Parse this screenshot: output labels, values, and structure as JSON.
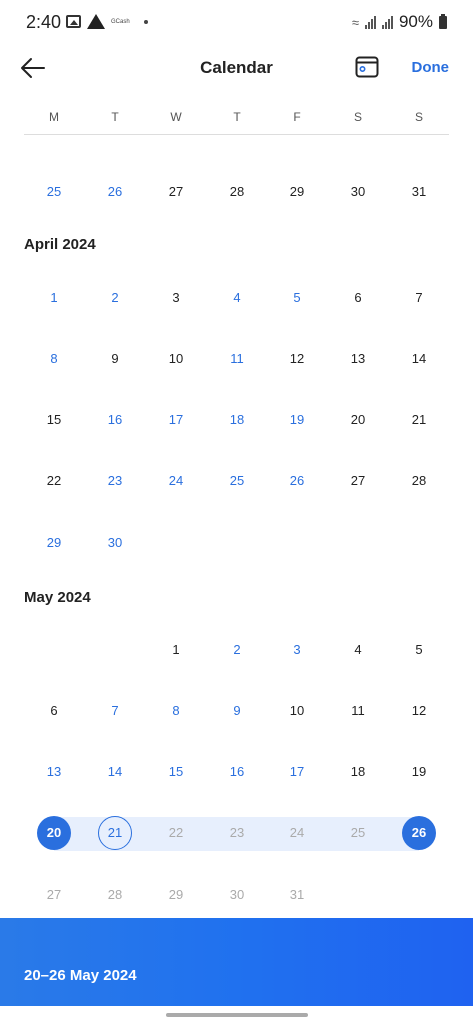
{
  "status": {
    "time": "2:40",
    "notification_text": "GCash",
    "battery": "90%"
  },
  "header": {
    "title": "Calendar",
    "done_label": "Done",
    "back_icon": "arrow-left-icon",
    "today_icon": "calendar-today-icon"
  },
  "weekdays": [
    "M",
    "T",
    "W",
    "T",
    "F",
    "S",
    "S"
  ],
  "colors": {
    "accent": "#2a6fde",
    "range_band": "#e7effd",
    "muted": "#aaaaaa"
  },
  "calendar": {
    "previous_week": [
      {
        "label": "25",
        "state": "avail"
      },
      {
        "label": "26",
        "state": "avail"
      },
      {
        "label": "27",
        "state": "normal"
      },
      {
        "label": "28",
        "state": "normal"
      },
      {
        "label": "29",
        "state": "normal"
      },
      {
        "label": "30",
        "state": "normal"
      },
      {
        "label": "31",
        "state": "normal"
      }
    ],
    "months": [
      {
        "title": "April 2024",
        "leading_blanks": 0,
        "days": [
          {
            "label": "1",
            "state": "avail"
          },
          {
            "label": "2",
            "state": "avail"
          },
          {
            "label": "3",
            "state": "normal"
          },
          {
            "label": "4",
            "state": "avail"
          },
          {
            "label": "5",
            "state": "avail"
          },
          {
            "label": "6",
            "state": "normal"
          },
          {
            "label": "7",
            "state": "normal"
          },
          {
            "label": "8",
            "state": "avail"
          },
          {
            "label": "9",
            "state": "normal"
          },
          {
            "label": "10",
            "state": "normal"
          },
          {
            "label": "11",
            "state": "avail"
          },
          {
            "label": "12",
            "state": "normal"
          },
          {
            "label": "13",
            "state": "normal"
          },
          {
            "label": "14",
            "state": "normal"
          },
          {
            "label": "15",
            "state": "normal"
          },
          {
            "label": "16",
            "state": "avail"
          },
          {
            "label": "17",
            "state": "avail"
          },
          {
            "label": "18",
            "state": "avail"
          },
          {
            "label": "19",
            "state": "avail"
          },
          {
            "label": "20",
            "state": "normal"
          },
          {
            "label": "21",
            "state": "normal"
          },
          {
            "label": "22",
            "state": "normal"
          },
          {
            "label": "23",
            "state": "avail"
          },
          {
            "label": "24",
            "state": "avail"
          },
          {
            "label": "25",
            "state": "avail"
          },
          {
            "label": "26",
            "state": "avail"
          },
          {
            "label": "27",
            "state": "normal"
          },
          {
            "label": "28",
            "state": "normal"
          },
          {
            "label": "29",
            "state": "avail"
          },
          {
            "label": "30",
            "state": "avail"
          }
        ]
      },
      {
        "title": "May 2024",
        "leading_blanks": 2,
        "days": [
          {
            "label": "1",
            "state": "normal"
          },
          {
            "label": "2",
            "state": "avail"
          },
          {
            "label": "3",
            "state": "avail"
          },
          {
            "label": "4",
            "state": "normal"
          },
          {
            "label": "5",
            "state": "normal"
          },
          {
            "label": "6",
            "state": "normal"
          },
          {
            "label": "7",
            "state": "avail"
          },
          {
            "label": "8",
            "state": "avail"
          },
          {
            "label": "9",
            "state": "avail"
          },
          {
            "label": "10",
            "state": "normal"
          },
          {
            "label": "11",
            "state": "normal"
          },
          {
            "label": "12",
            "state": "normal"
          },
          {
            "label": "13",
            "state": "avail"
          },
          {
            "label": "14",
            "state": "avail"
          },
          {
            "label": "15",
            "state": "avail"
          },
          {
            "label": "16",
            "state": "avail"
          },
          {
            "label": "17",
            "state": "avail"
          },
          {
            "label": "18",
            "state": "normal"
          },
          {
            "label": "19",
            "state": "normal"
          },
          {
            "label": "20",
            "state": "sel-end"
          },
          {
            "label": "21",
            "state": "sel-outline"
          },
          {
            "label": "22",
            "state": "in-range"
          },
          {
            "label": "23",
            "state": "in-range"
          },
          {
            "label": "24",
            "state": "in-range"
          },
          {
            "label": "25",
            "state": "in-range"
          },
          {
            "label": "26",
            "state": "sel-end"
          },
          {
            "label": "27",
            "state": "muted"
          },
          {
            "label": "28",
            "state": "muted"
          },
          {
            "label": "29",
            "state": "muted"
          },
          {
            "label": "30",
            "state": "muted"
          },
          {
            "label": "31",
            "state": "muted"
          }
        ]
      }
    ]
  },
  "footer": {
    "selected_range": "20–26 May 2024"
  }
}
